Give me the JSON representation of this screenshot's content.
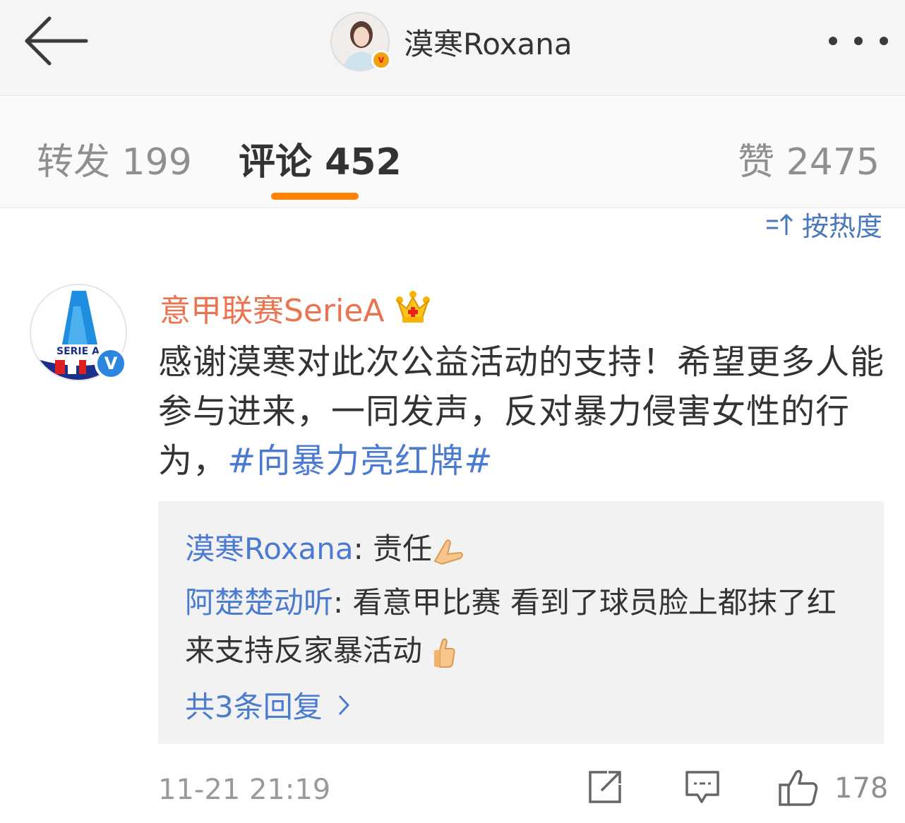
{
  "header": {
    "user_name": "漠寒Roxana",
    "back_icon": "arrow-left-icon",
    "more_icon": "more-dots-icon",
    "vip_badge": "v"
  },
  "tabs": [
    {
      "label": "转发 199"
    },
    {
      "label": "评论 452"
    },
    {
      "label": "赞 2475"
    }
  ],
  "sort": {
    "label": "按热度",
    "icon": "sort-icon"
  },
  "comment": {
    "author": "意甲联赛SerieA",
    "avatar_logo_text": "SERIE A",
    "verified_badge": "V",
    "text_before": "感谢漠寒对此次公益活动的支持！希望更多人能参与进来，一同发声，反对暴力侵害女性的行为，",
    "hashtag": "#向暴力亮红牌#",
    "replies": [
      {
        "user": "漠寒Roxana",
        "sep": ": ",
        "text": "责任",
        "emoji": "folded-hands-emoji"
      },
      {
        "user": "阿楚楚动听",
        "sep": ": ",
        "text": "看意甲比赛 看到了球员脸上都抹了红来支持反家暴活动 ",
        "emoji": "thumbs-up-emoji"
      }
    ],
    "more_replies": "共3条回复",
    "timestamp": "11-21 21:19",
    "like_count": "178"
  },
  "colors": {
    "accent": "#ff8200",
    "link": "#4a7bd0",
    "author": "#eb7350",
    "verified": "#2c86e0"
  }
}
